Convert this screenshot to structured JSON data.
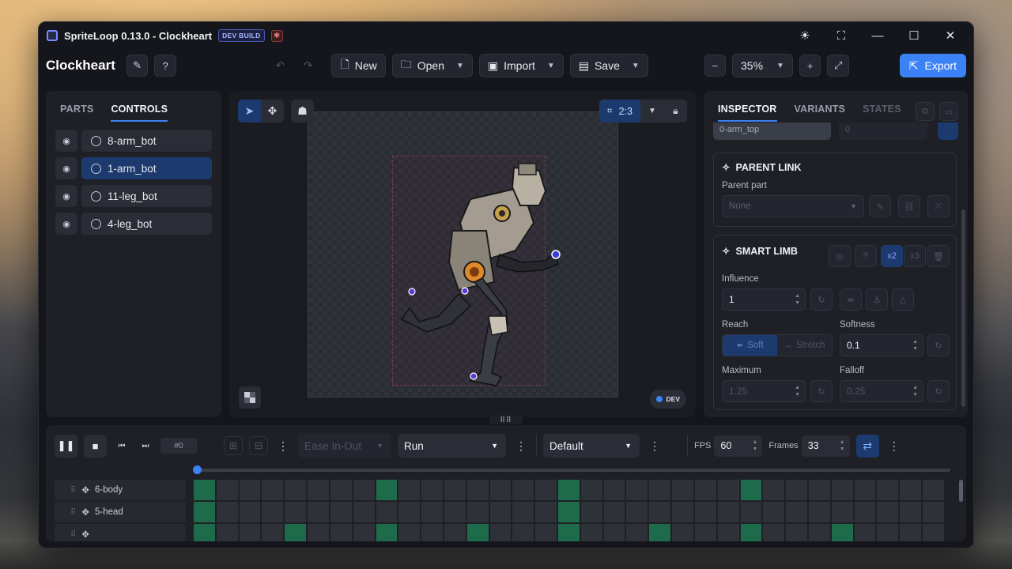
{
  "window": {
    "title": "SpriteLoop 0.13.0 - Clockheart",
    "badge": "DEV BUILD"
  },
  "toolbar": {
    "project": "Clockheart",
    "new_label": "New",
    "open_label": "Open",
    "import_label": "Import",
    "save_label": "Save",
    "zoom": "35%",
    "export_label": "Export"
  },
  "left_panel": {
    "tabs": [
      "PARTS",
      "CONTROLS"
    ],
    "active_tab": "CONTROLS",
    "controls": [
      "8-arm_bot",
      "1-arm_bot",
      "11-leg_bot",
      "4-leg_bot"
    ],
    "selected": "1-arm_bot"
  },
  "canvas": {
    "aspect": "2:3",
    "dev_label": "DEV"
  },
  "inspector": {
    "tabs": [
      "INSPECTOR",
      "VARIANTS",
      "STATES"
    ],
    "partial_part": "0-arm_top",
    "partial_num": "0",
    "parent_link": {
      "title": "PARENT LINK",
      "parent_label": "Parent part",
      "parent_value": "None"
    },
    "smart_limb": {
      "title": "SMART LIMB",
      "x2": "x2",
      "x3": "x3",
      "influence_label": "Influence",
      "influence": "1",
      "reach_label": "Reach",
      "reach_soft": "Soft",
      "reach_stretch": "Stretch",
      "softness_label": "Softness",
      "softness": "0.1",
      "maximum_label": "Maximum",
      "maximum": "1.25",
      "falloff_label": "Falloff",
      "falloff": "0.25"
    }
  },
  "timeline": {
    "frame_index": "#0",
    "easing": "Ease In-Out",
    "animation": "Run",
    "variant": "Default",
    "fps_label": "FPS",
    "fps": "60",
    "frames_label": "Frames",
    "frames": "33",
    "tracks": [
      {
        "name": "6-body",
        "keys": [
          0,
          8,
          16,
          24
        ]
      },
      {
        "name": "5-head",
        "keys": [
          0,
          16
        ]
      },
      {
        "name": "",
        "keys": [
          0,
          4,
          8,
          12,
          16,
          20,
          24,
          28
        ]
      }
    ],
    "cell_count": 33
  },
  "colors": {
    "accent": "#3b82f6",
    "selected": "#1d3a6e",
    "keyframe": "#1e6b4c"
  }
}
